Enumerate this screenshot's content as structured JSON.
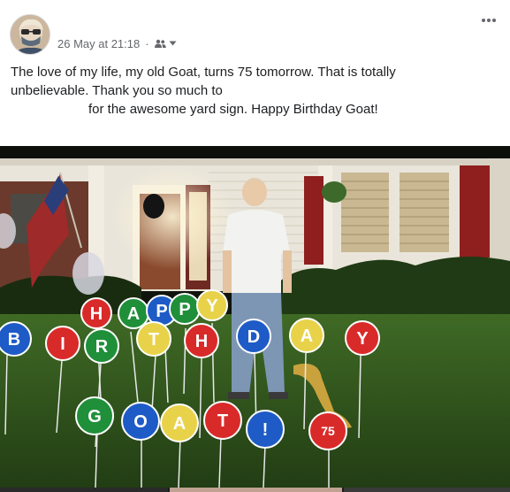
{
  "post": {
    "timestamp": "26 May at 21:18",
    "audience_icon": "friends-icon",
    "audience_dropdown_icon": "chevron-down-icon",
    "more_icon": "more-horizontal-icon",
    "text_line1": "The love of my life, my old Goat, turns 75 tomorrow. That is totally",
    "text_line2": "unbelievable. Thank you so much to",
    "text_line3": "for the awesome yard sign. Happy Birthday Goat!"
  },
  "photo": {
    "sign_letters": {
      "row1": [
        "H",
        "A",
        "P",
        "P",
        "Y"
      ],
      "row2": [
        "B",
        "I",
        "R",
        "T",
        "H",
        "D",
        "A",
        "Y"
      ],
      "row3": [
        "G",
        "O",
        "A",
        "T",
        "!",
        "75"
      ]
    }
  },
  "colors": {
    "text": "#1c1e21",
    "meta": "#65676b",
    "sign_red": "#d92a2a",
    "sign_blue": "#1e5bc6",
    "sign_green": "#1f8f3a",
    "sign_yellow": "#e8d24a"
  }
}
